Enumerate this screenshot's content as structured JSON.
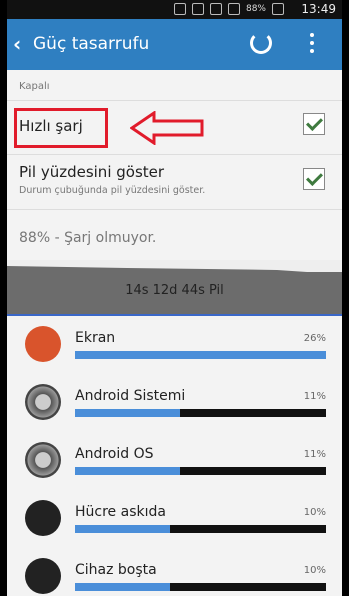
{
  "status_bar": {
    "battery": "88%",
    "time": "13:49"
  },
  "action_bar": {
    "title": "Güç tasarrufu"
  },
  "settings": {
    "partial_value": "Kapalı",
    "fast_charge": {
      "label": "Hızlı şarj",
      "checked": true
    },
    "battery_percent": {
      "label": "Pil yüzdesini göster",
      "description": "Durum çubuğunda pil yüzdesini göster.",
      "checked": true
    }
  },
  "battery_status": "88% - Şarj olmuyor.",
  "graph": {
    "label": "14s 12d 44s Pil"
  },
  "apps": [
    {
      "name": "Ekran",
      "percent": "26%",
      "fill": 1.0,
      "icon": "screen-icon",
      "color": "#d9542c"
    },
    {
      "name": "Android Sistemi",
      "percent": "11%",
      "fill": 0.42,
      "icon": "android-system-icon",
      "color": "#555555"
    },
    {
      "name": "Android OS",
      "percent": "11%",
      "fill": 0.42,
      "icon": "android-os-icon",
      "color": "#555555"
    },
    {
      "name": "Hücre askıda",
      "percent": "10%",
      "fill": 0.38,
      "icon": "cell-standby-icon",
      "color": "#333333"
    },
    {
      "name": "Cihaz boşta",
      "percent": "10%",
      "fill": 0.38,
      "icon": "device-idle-icon",
      "color": "#333333"
    }
  ],
  "colors": {
    "accent": "#2f7fc1",
    "annotation": "#e11b2b",
    "bar": "#4a8ed9"
  }
}
